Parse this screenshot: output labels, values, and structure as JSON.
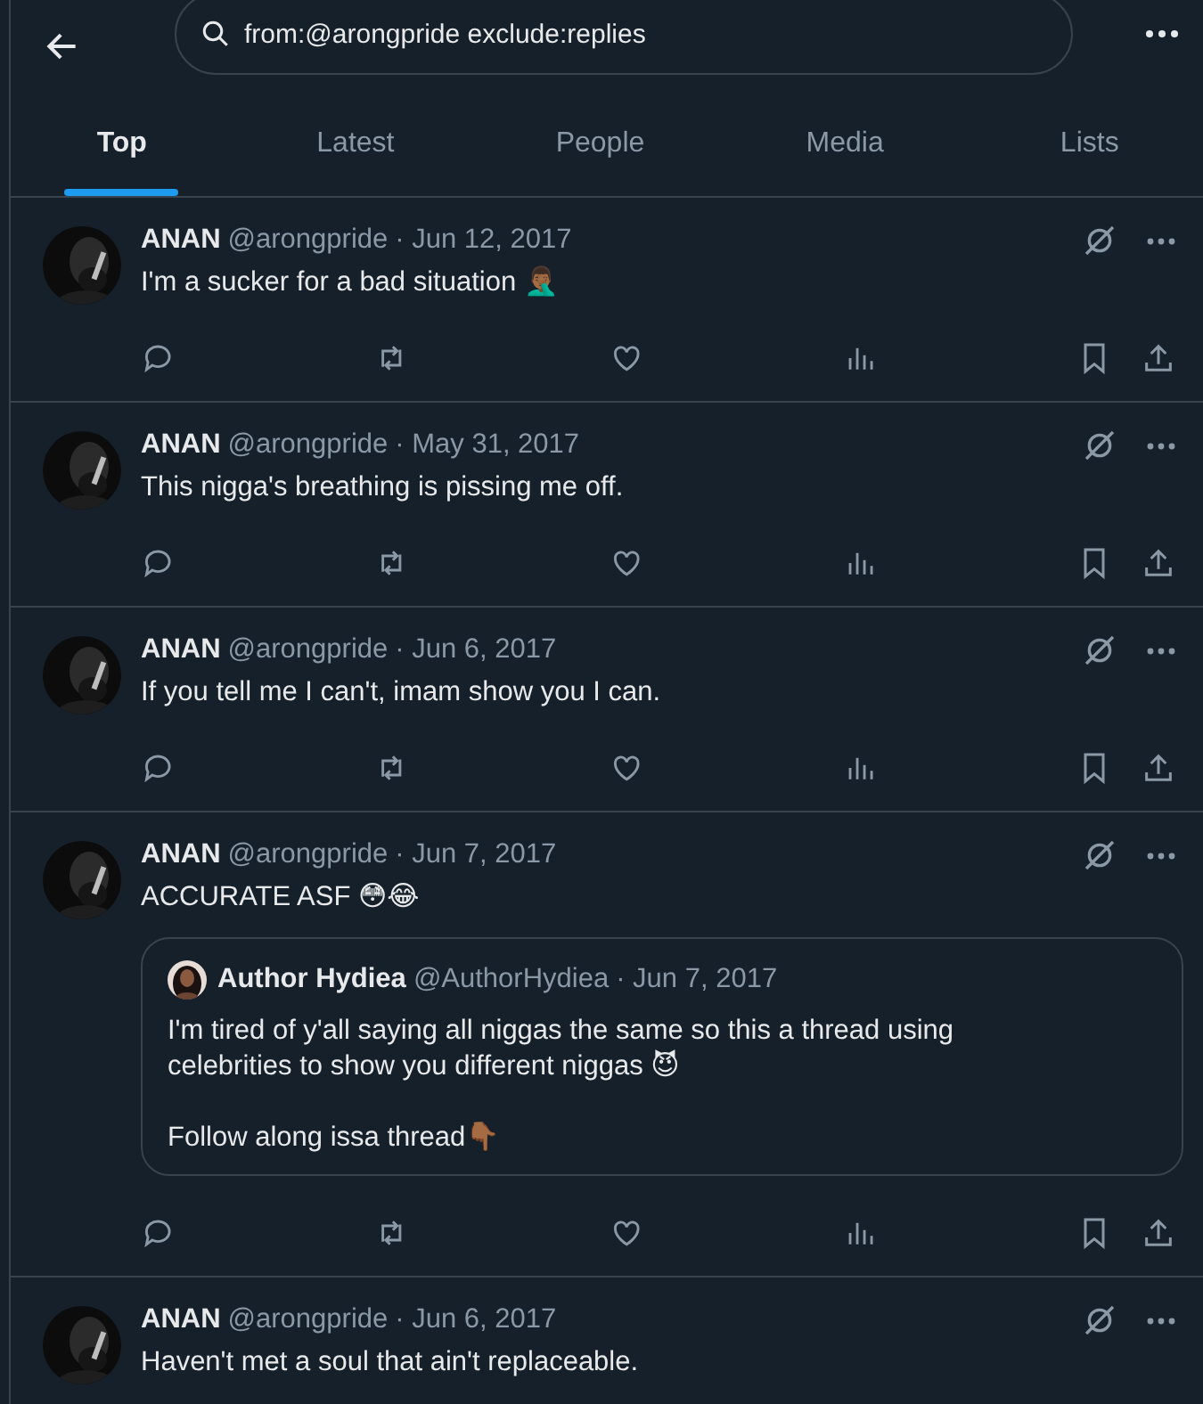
{
  "search": {
    "value": "from:@arongpride exclude:replies"
  },
  "tabs": [
    {
      "label": "Top",
      "selected": true
    },
    {
      "label": "Latest",
      "selected": false
    },
    {
      "label": "People",
      "selected": false
    },
    {
      "label": "Media",
      "selected": false
    },
    {
      "label": "Lists",
      "selected": false
    }
  ],
  "tweets": [
    {
      "name": "ANAN",
      "handle": "@arongpride",
      "date": "· Jun 12, 2017",
      "text": "I'm a sucker for a bad situation 🤦🏾‍♂️",
      "actions_visible": true
    },
    {
      "name": "ANAN",
      "handle": "@arongpride",
      "date": "· May 31, 2017",
      "text": "This nigga's breathing is pissing me off.",
      "actions_visible": true
    },
    {
      "name": "ANAN",
      "handle": "@arongpride",
      "date": "· Jun 6, 2017",
      "text": "If you tell me I can't, imam show you I can.",
      "actions_visible": true
    },
    {
      "name": "ANAN",
      "handle": "@arongpride",
      "date": "· Jun 7, 2017",
      "text": "ACCURATE ASF 😳😂",
      "actions_visible": true,
      "quote": {
        "name": "Author Hydiea",
        "handle": "@AuthorHydiea",
        "date": "· Jun 7, 2017",
        "paragraphs": [
          "I'm tired of y'all saying all niggas the same so this a thread using celebrities to show you different niggas 😈",
          "Follow along issa thread👇🏾"
        ]
      }
    },
    {
      "name": "ANAN",
      "handle": "@arongpride",
      "date": "· Jun 6, 2017",
      "text": "Haven't met a soul that ain't replaceable.",
      "actions_visible": false
    }
  ]
}
